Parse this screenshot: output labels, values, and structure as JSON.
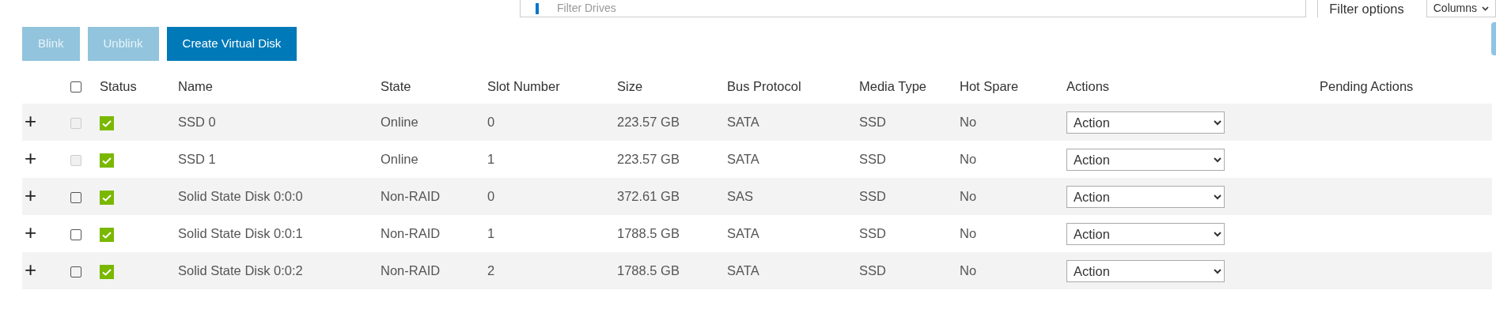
{
  "filter": {
    "placeholder": "Filter Drives",
    "options_label": "Filter options",
    "columns_label": "Columns"
  },
  "buttons": [
    {
      "label": "Blink",
      "disabled": true
    },
    {
      "label": "Unblink",
      "disabled": true
    },
    {
      "label": "Create Virtual Disk",
      "disabled": false
    }
  ],
  "table": {
    "select_all": {
      "checked": false
    },
    "columns": [
      "Status",
      "Name",
      "State",
      "Slot Number",
      "Size",
      "Bus Protocol",
      "Media Type",
      "Hot Spare",
      "Actions",
      "Pending Actions"
    ],
    "rows": [
      {
        "expand": "+",
        "disabled": true,
        "checked": false,
        "healthy": true,
        "name": "SSD 0",
        "state": "Online",
        "slot": "0",
        "size": "223.57 GB",
        "bus": "SATA",
        "media": "SSD",
        "hot_spare": "No",
        "action": "Action"
      },
      {
        "expand": "+",
        "disabled": true,
        "checked": false,
        "healthy": true,
        "name": "SSD 1",
        "state": "Online",
        "slot": "1",
        "size": "223.57 GB",
        "bus": "SATA",
        "media": "SSD",
        "hot_spare": "No",
        "action": "Action"
      },
      {
        "expand": "+",
        "disabled": false,
        "checked": false,
        "healthy": true,
        "name": "Solid State Disk 0:0:0",
        "state": "Non-RAID",
        "slot": "0",
        "size": "372.61 GB",
        "bus": "SAS",
        "media": "SSD",
        "hot_spare": "No",
        "action": "Action"
      },
      {
        "expand": "+",
        "disabled": false,
        "checked": false,
        "healthy": true,
        "name": "Solid State Disk 0:0:1",
        "state": "Non-RAID",
        "slot": "1",
        "size": "1788.5 GB",
        "bus": "SATA",
        "media": "SSD",
        "hot_spare": "No",
        "action": "Action"
      },
      {
        "expand": "+",
        "disabled": false,
        "checked": false,
        "healthy": true,
        "name": "Solid State Disk 0:0:2",
        "state": "Non-RAID",
        "slot": "2",
        "size": "1788.5 GB",
        "bus": "SATA",
        "media": "SSD",
        "hot_spare": "No",
        "action": "Action"
      }
    ]
  }
}
